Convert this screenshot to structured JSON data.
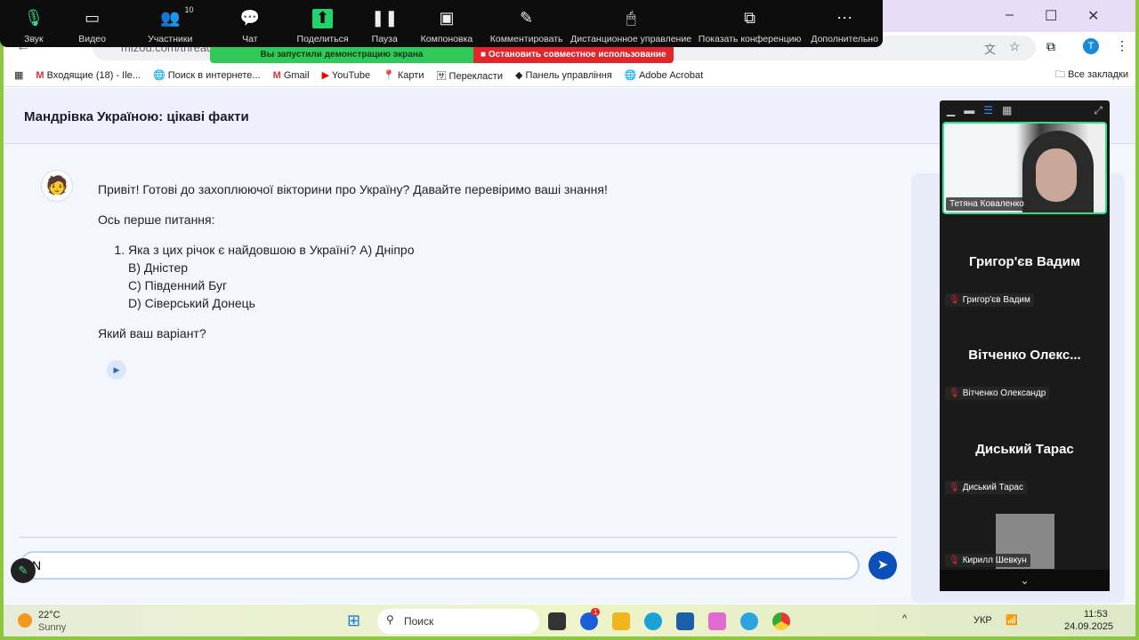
{
  "browser": {
    "url": "mizou.com/thread/",
    "window_controls": [
      "–",
      "☐",
      "✕"
    ],
    "profile_initial": "T",
    "bookmarks": [
      "Входящие (18) - Ile...",
      "Поиск в интернете...",
      "Gmail",
      "YouTube",
      "Карти",
      "Перекласти",
      "Панель управління",
      "Adobe Acrobat"
    ],
    "all_bookmarks": "Все закладки"
  },
  "zoom_toolbar": {
    "items": [
      {
        "label": "Звук",
        "icon": "🎙"
      },
      {
        "label": "Видео",
        "icon": "▭"
      },
      {
        "label": "Участники",
        "icon": "👥",
        "badge": "10"
      },
      {
        "label": "Чат",
        "icon": "💬"
      },
      {
        "label": "Поделиться",
        "icon": "⬆"
      },
      {
        "label": "Пауза",
        "icon": "❚❚"
      },
      {
        "label": "Компоновка",
        "icon": "▣"
      },
      {
        "label": "Комментировать",
        "icon": "✎"
      },
      {
        "label": "Дистанционное управление",
        "icon": "🖱"
      },
      {
        "label": "Показать конференцию",
        "icon": "⧉"
      },
      {
        "label": "Дополнительно",
        "icon": "⋯"
      }
    ],
    "sharing_banner": "Вы запустили демонстрацию экрана",
    "stop_sharing": "Остановить совместное использование"
  },
  "page": {
    "title": "Мандрівка Україною: цікаві факти",
    "message": {
      "greeting": "Привіт! Готові до захоплюючої вікторини про Україну? Давайте перевіримо ваші знання!",
      "intro": "Ось перше питання:",
      "question": "Яка з цих річок є найдовшою в Україні? A) Дніпро",
      "options": [
        "B) Дністер",
        "C) Південний Буг",
        "D) Сіверський Донець"
      ],
      "prompt": "Який ваш варіант?"
    },
    "input_value": "N"
  },
  "zoom_panel": {
    "self_name": "Тетяна  Коваленко",
    "participants": [
      {
        "title": "Григор'єв Вадим",
        "label": "Григор'єв Вадим"
      },
      {
        "title": "Вітченко  Олекс...",
        "label": "Вітченко Олександр"
      },
      {
        "title": "Диський Тарас",
        "label": "Диський Тарас"
      },
      {
        "title": "",
        "label": "Кирилл Шевкун"
      }
    ]
  },
  "taskbar": {
    "temp": "22°C",
    "weather": "Sunny",
    "search": "Поиск",
    "lang": "УКР",
    "time": "11:53",
    "date": "24.09.2025",
    "badge": "1"
  }
}
